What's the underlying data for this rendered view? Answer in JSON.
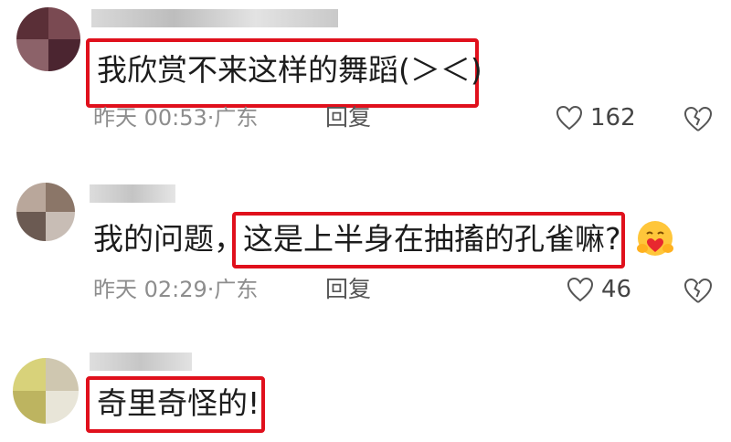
{
  "comments": [
    {
      "text_highlighted": "我欣赏不来这样的舞蹈(＞＜)",
      "text_plain": "",
      "time": "昨天 00:53·广东",
      "reply_label": "回复",
      "likes": "162"
    },
    {
      "text_plain": "我的问题，",
      "text_highlighted": "这是上半身在抽搐的孔雀嘛?",
      "time": "昨天 02:29·广东",
      "reply_label": "回复",
      "likes": "46",
      "emoji": "hug-emoji"
    },
    {
      "text_highlighted": "奇里奇怪的!",
      "text_plain": ""
    }
  ],
  "colors": {
    "highlight_border": "#e0101c",
    "meta_text": "#8d8d8d"
  }
}
